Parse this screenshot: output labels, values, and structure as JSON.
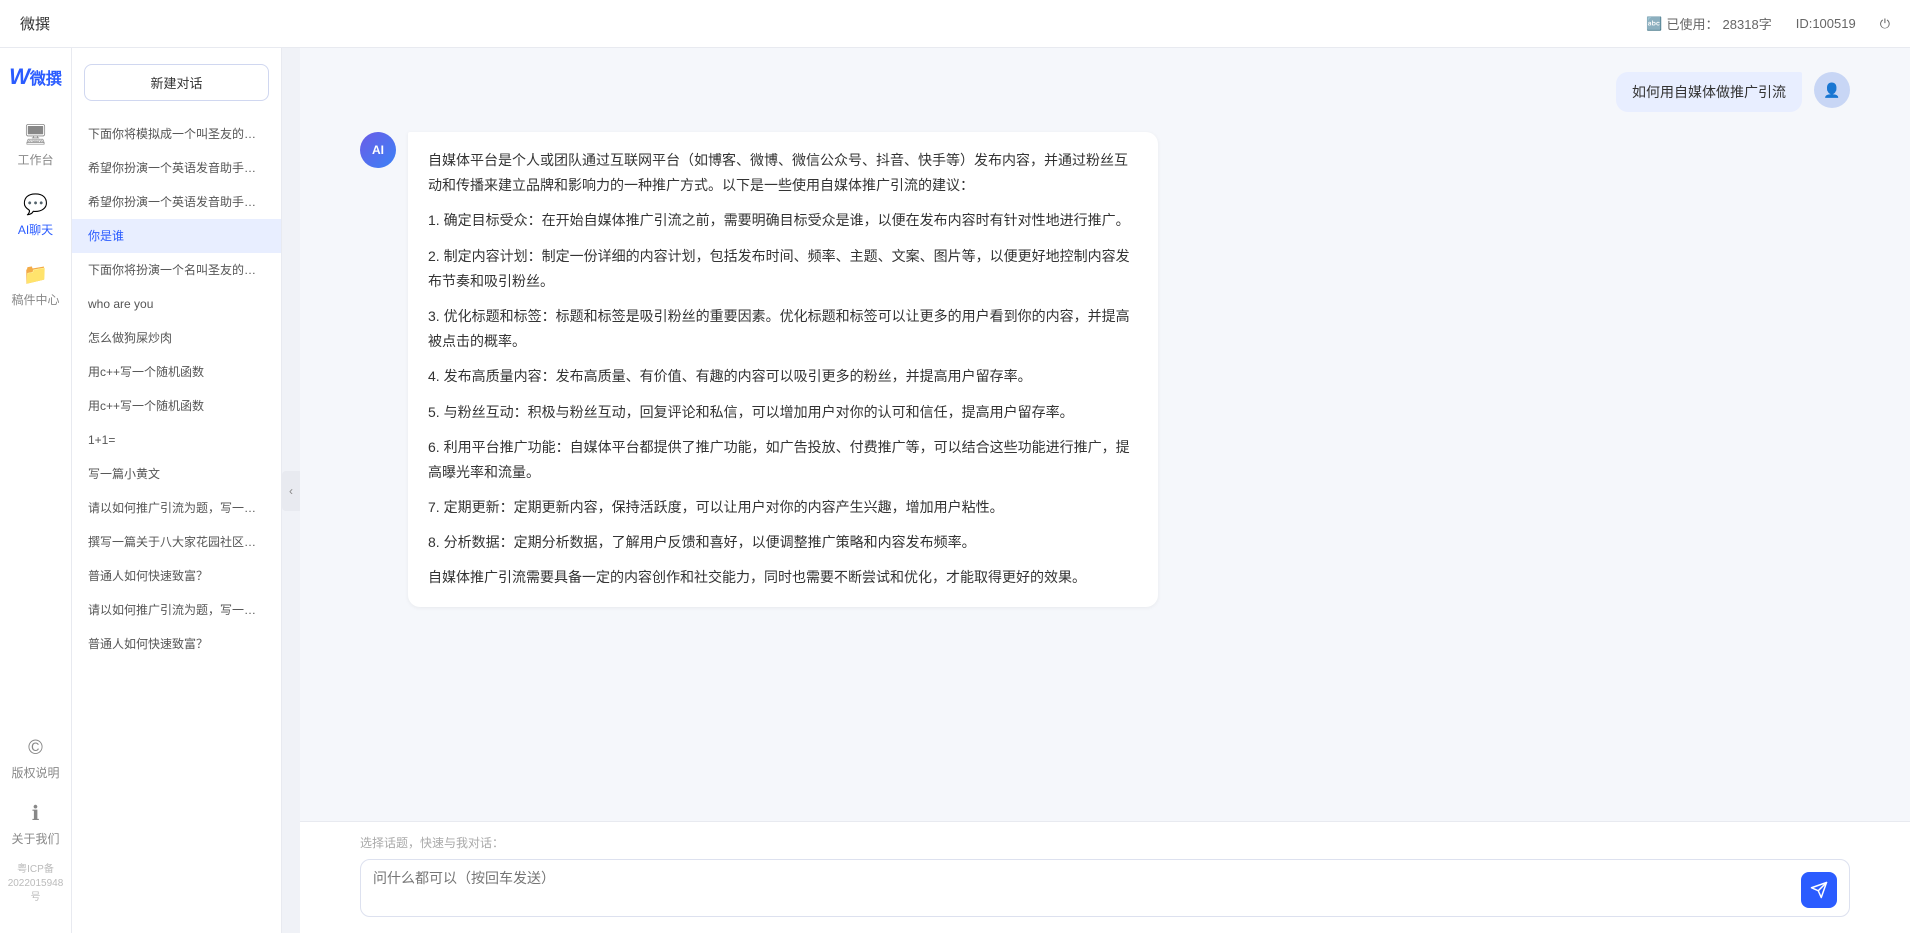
{
  "topbar": {
    "title": "微撰",
    "usage_label": "已使用：",
    "usage_value": "28318字",
    "id_label": "ID:100519",
    "usage_icon": "📊"
  },
  "nav": {
    "logo_w": "W",
    "logo_text": "微撰",
    "items": [
      {
        "id": "workbench",
        "icon": "🖥",
        "label": "工作台"
      },
      {
        "id": "ai-chat",
        "icon": "💬",
        "label": "AI聊天"
      },
      {
        "id": "drafts",
        "icon": "📁",
        "label": "稿件中心"
      }
    ],
    "bottom_items": [
      {
        "id": "copyright",
        "icon": "©",
        "label": "版权说明"
      },
      {
        "id": "about",
        "icon": "ℹ",
        "label": "关于我们"
      }
    ],
    "icp": "粤ICP备2022015948号"
  },
  "sidebar": {
    "new_chat": "新建对话",
    "history": [
      {
        "id": 1,
        "text": "下面你将模拟成一个叫圣友的程序员、我说..."
      },
      {
        "id": 2,
        "text": "希望你扮演一个英语发音助手，我提供给你..."
      },
      {
        "id": 3,
        "text": "希望你扮演一个英语发音助手，我提供给你..."
      },
      {
        "id": 4,
        "text": "你是谁",
        "active": true
      },
      {
        "id": 5,
        "text": "下面你将扮演一个名叫圣友的医生"
      },
      {
        "id": 6,
        "text": "who are you"
      },
      {
        "id": 7,
        "text": "怎么做狗屎炒肉"
      },
      {
        "id": 8,
        "text": "用c++写一个随机函数"
      },
      {
        "id": 9,
        "text": "用c++写一个随机函数"
      },
      {
        "id": 10,
        "text": "1+1="
      },
      {
        "id": 11,
        "text": "写一篇小黄文"
      },
      {
        "id": 12,
        "text": "请以如何推广引流为题，写一篇大纲"
      },
      {
        "id": 13,
        "text": "撰写一篇关于八大家花园社区一刻钟便民生..."
      },
      {
        "id": 14,
        "text": "普通人如何快速致富？"
      },
      {
        "id": 15,
        "text": "请以如何推广引流为题，写一篇大纲"
      },
      {
        "id": 16,
        "text": "普通人如何快速致富？"
      }
    ]
  },
  "chat": {
    "user_message": "如何用自媒体做推广引流",
    "ai_response_paragraphs": [
      "自媒体平台是个人或团队通过互联网平台（如博客、微博、微信公众号、抖音、快手等）发布内容，并通过粉丝互动和传播来建立品牌和影响力的一种推广方式。以下是一些使用自媒体推广引流的建议：",
      "1. 确定目标受众：在开始自媒体推广引流之前，需要明确目标受众是谁，以便在发布内容时有针对性地进行推广。",
      "2. 制定内容计划：制定一份详细的内容计划，包括发布时间、频率、主题、文案、图片等，以便更好地控制内容发布节奏和吸引粉丝。",
      "3. 优化标题和标签：标题和标签是吸引粉丝的重要因素。优化标题和标签可以让更多的用户看到你的内容，并提高被点击的概率。",
      "4. 发布高质量内容：发布高质量、有价值、有趣的内容可以吸引更多的粉丝，并提高用户留存率。",
      "5. 与粉丝互动：积极与粉丝互动，回复评论和私信，可以增加用户对你的认可和信任，提高用户留存率。",
      "6. 利用平台推广功能：自媒体平台都提供了推广功能，如广告投放、付费推广等，可以结合这些功能进行推广，提高曝光率和流量。",
      "7. 定期更新：定期更新内容，保持活跃度，可以让用户对你的内容产生兴趣，增加用户粘性。",
      "8. 分析数据：定期分析数据，了解用户反馈和喜好，以便调整推广策略和内容发布频率。",
      "自媒体推广引流需要具备一定的内容创作和社交能力，同时也需要不断尝试和优化，才能取得更好的效果。"
    ]
  },
  "input": {
    "quick_topic_label": "选择话题，快速与我对话：",
    "placeholder": "问什么都可以（按回车发送）"
  }
}
